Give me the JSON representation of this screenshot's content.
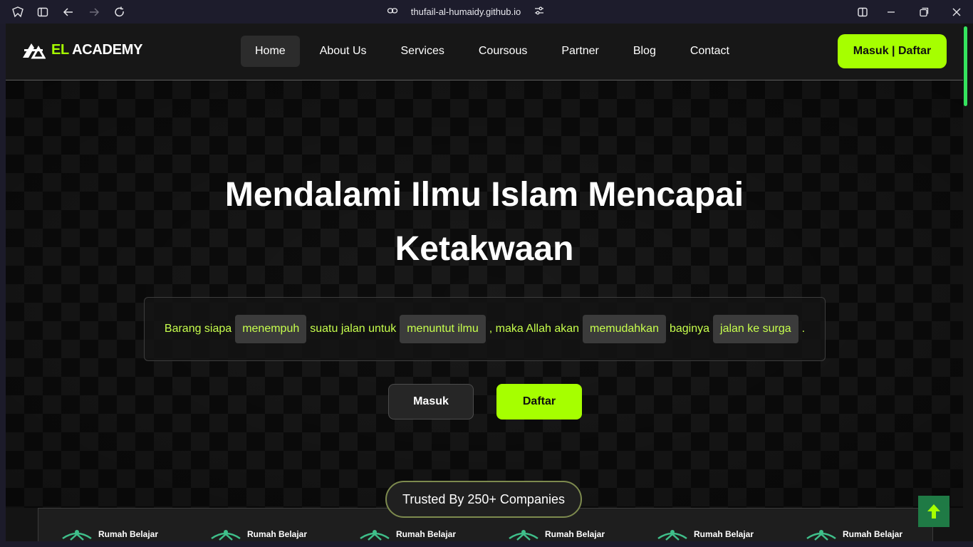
{
  "browser": {
    "url": "thufail-al-humaidy.github.io"
  },
  "nav": {
    "brand_accent": "EL",
    "brand_rest": " ACADEMY",
    "items": [
      {
        "label": "Home",
        "active": true
      },
      {
        "label": "About Us"
      },
      {
        "label": "Services"
      },
      {
        "label": "Coursous"
      },
      {
        "label": "Partner"
      },
      {
        "label": "Blog"
      },
      {
        "label": "Contact"
      }
    ],
    "login_label": "Masuk | Daftar"
  },
  "hero": {
    "title_line1": "Mendalami Ilmu Islam Mencapai",
    "title_line2": "Ketakwaan",
    "quote": {
      "t1": "Barang siapa",
      "c1": "menempuh",
      "t2": "suatu jalan untuk",
      "c2": "menuntut ilmu",
      "t3": ", maka Allah akan",
      "c3": "memudahkan",
      "t4": "baginya",
      "c4": "jalan ke surga",
      "t5": "."
    },
    "masuk_label": "Masuk",
    "daftar_label": "Daftar"
  },
  "partners": {
    "trusted_label": "Trusted By 250+ Companies",
    "items": [
      "Rumah Belajar",
      "Rumah Belajar",
      "Rumah Belajar",
      "Rumah Belajar",
      "Rumah Belajar",
      "Rumah Belajar"
    ]
  },
  "colors": {
    "accent": "#a6ff00",
    "quote_text": "#c7ff4d",
    "scroll_top": "#1f7a45",
    "scrollbar_thumb": "#35e35e"
  },
  "icons": {
    "browser": [
      "app-icon",
      "sidebar-toggle-icon",
      "back-icon",
      "forward-icon",
      "reload-icon",
      "link-icon",
      "tune-icon",
      "split-view-icon",
      "minimize-icon",
      "restore-icon",
      "close-icon"
    ],
    "scroll_top": "arrow-up-icon"
  }
}
